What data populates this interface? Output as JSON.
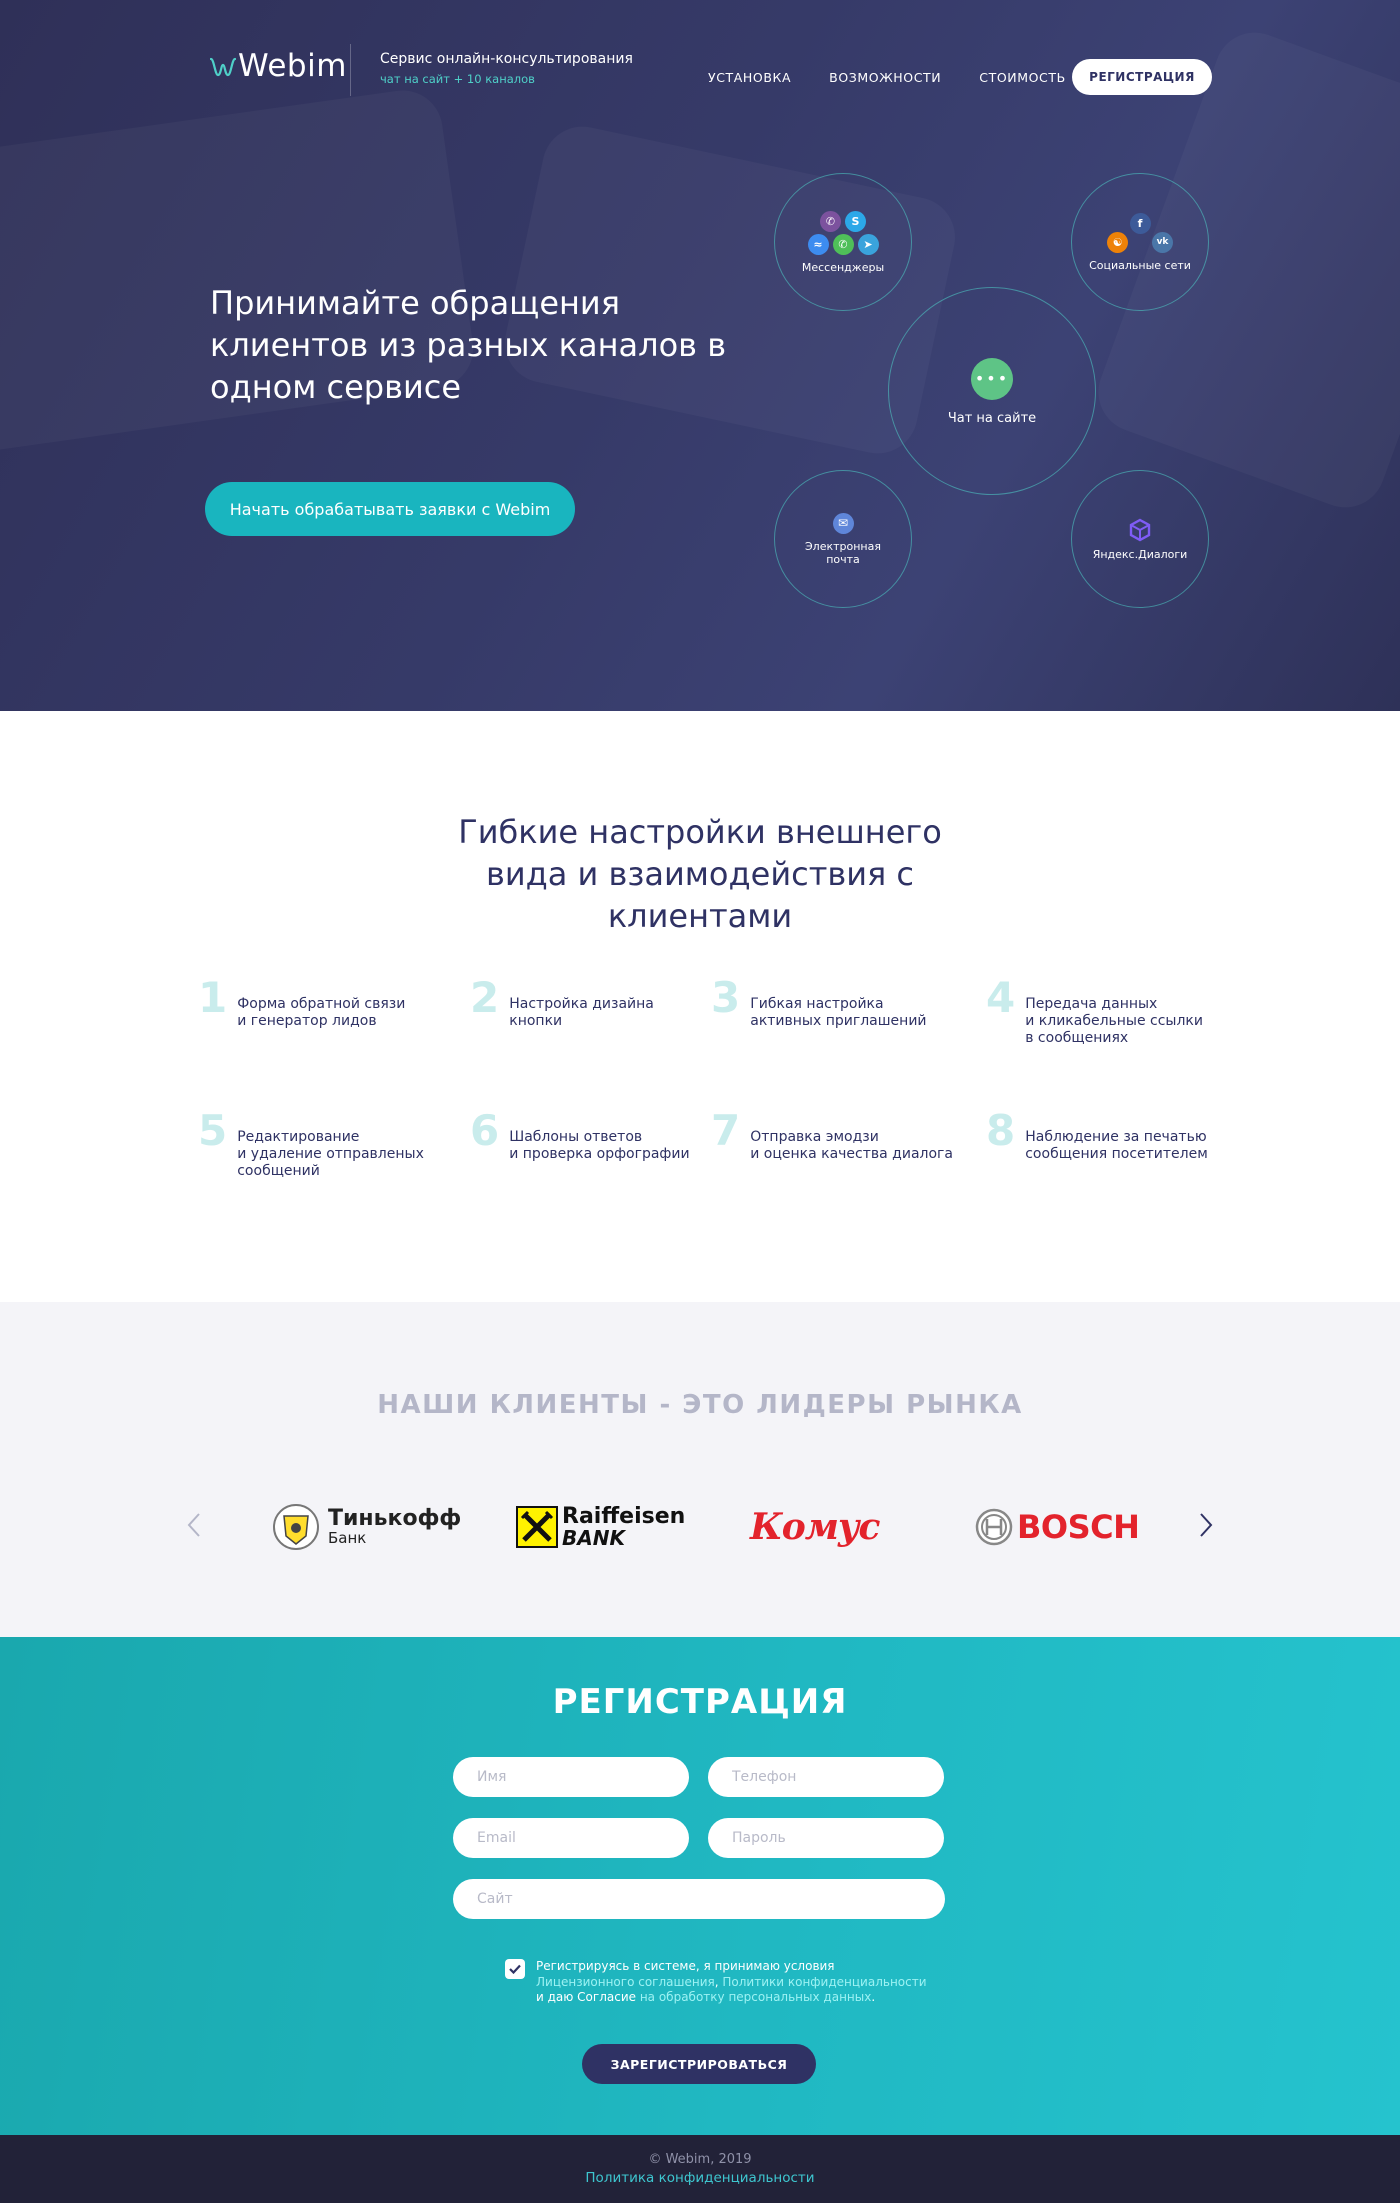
{
  "brand": {
    "name": "Webim",
    "accent": "#19b5bf",
    "dark": "#2f3264"
  },
  "header": {
    "service_title": "Сервис онлайн-консультирования",
    "service_subtitle": "чат на сайт + 10 каналов",
    "nav": [
      "УСТАНОВКА",
      "ВОЗМОЖНОСТИ",
      "СТОИМОСТЬ"
    ],
    "register_button": "РЕГИСТРАЦИЯ"
  },
  "hero": {
    "title": "Принимайте обращения клиентов из разных каналов в одном сервисе",
    "cta": "Начать обрабатывать заявки с Webim",
    "channels": {
      "messengers": "Мессенджеры",
      "social": "Социальные сети",
      "site_chat": "Чат на сайте",
      "email": "Электронная почта",
      "yandex": "Яндекс.Диалоги"
    },
    "icons": [
      "viber-icon",
      "skype-icon",
      "messenger-icon",
      "whatsapp-icon",
      "telegram-icon",
      "facebook-icon",
      "odnoklassniki-icon",
      "vk-icon",
      "chat-bubble-icon",
      "mail-icon",
      "yandex-dialogs-icon"
    ]
  },
  "features": {
    "title": "Гибкие настройки внешнего вида и взаимодействия с клиентами",
    "items": [
      {
        "num": "1",
        "text": "Форма обратной связи\nи генератор лидов"
      },
      {
        "num": "2",
        "text": "Настройка дизайна\nкнопки"
      },
      {
        "num": "3",
        "text": "Гибкая настройка\nактивных приглашений"
      },
      {
        "num": "4",
        "text": "Передача данных\nи кликабельные ссылки\nв сообщениях"
      },
      {
        "num": "5",
        "text": "Редактирование\nи удаление отправленых\nсообщений"
      },
      {
        "num": "6",
        "text": "Шаблоны ответов\nи проверка орфографии"
      },
      {
        "num": "7",
        "text": "Отправка эмодзи\nи оценка качества диалога"
      },
      {
        "num": "8",
        "text": "Наблюдение за печатью\nсообщения посетителем"
      }
    ]
  },
  "clients": {
    "title": "НАШИ КЛИЕНТЫ - ЭТО ЛИДЕРЫ РЫНКА",
    "logos": [
      {
        "name": "Тинькофф",
        "sub": "Банк"
      },
      {
        "name": "Raiffeisen",
        "sub": "BANK"
      },
      {
        "name": "Комус"
      },
      {
        "name": "BOSCH"
      }
    ]
  },
  "registration": {
    "title": "РЕГИСТРАЦИЯ",
    "fields": {
      "name": "Имя",
      "phone": "Телефон",
      "email": "Email",
      "password": "Пароль",
      "site": "Сайт"
    },
    "agree_checked": true,
    "agree": {
      "line1": "Регистрируясь в системе, я принимаю условия",
      "link_license": "Лицензионного соглашения",
      "sep": ", ",
      "link_privacy": "Политики конфиденциальности",
      "line3_prefix": "и даю Согласие ",
      "link_personal": "на обработку персональных данных",
      "line3_suffix": "."
    },
    "submit": "ЗАРЕГИСТРИРОВАТЬСЯ"
  },
  "footer": {
    "copyright": "© Webim, 2019",
    "privacy": "Политика конфиденциальности"
  }
}
